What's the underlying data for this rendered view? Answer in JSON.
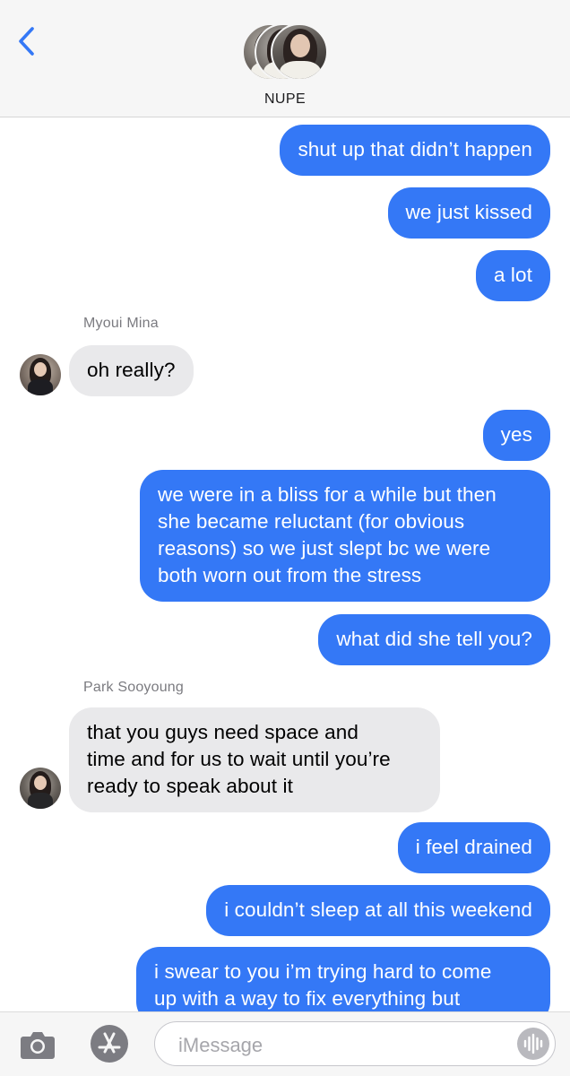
{
  "header": {
    "group_name": "NUPE",
    "back_icon": "chevron-left-icon",
    "accent_color": "#3478f6"
  },
  "messages": [
    {
      "type": "sent",
      "text": "shut up that didn’t happen"
    },
    {
      "type": "sent",
      "text": "we just kissed"
    },
    {
      "type": "sent",
      "text": "a lot"
    },
    {
      "type": "received",
      "sender": "Myoui Mina",
      "text": "oh really?"
    },
    {
      "type": "sent",
      "text": "yes"
    },
    {
      "type": "sent",
      "lines": [
        "we were in a bliss for a while but then",
        "she became reluctant (for obvious",
        "reasons) so we just slept bc we were",
        "both worn out from the stress"
      ]
    },
    {
      "type": "sent",
      "text": "what did she tell you?"
    },
    {
      "type": "received",
      "sender": "Park Sooyoung",
      "lines": [
        "that you guys need space and",
        "time and for us to wait until you’re",
        "ready to speak about it"
      ]
    },
    {
      "type": "sent",
      "text": "i feel drained"
    },
    {
      "type": "sent",
      "text": "i couldn’t sleep at all this weekend"
    },
    {
      "type": "sent",
      "lines": [
        "i swear to you i’m trying hard to come",
        "up with a way to fix everything but"
      ]
    }
  ],
  "composer": {
    "placeholder": "iMessage",
    "camera_icon": "camera-icon",
    "apps_icon": "app-store-icon",
    "audio_icon": "audio-waveform-icon"
  },
  "colors": {
    "sent_bubble": "#3478f6",
    "received_bubble": "#e9e9eb",
    "header_bg": "#f6f6f6"
  }
}
